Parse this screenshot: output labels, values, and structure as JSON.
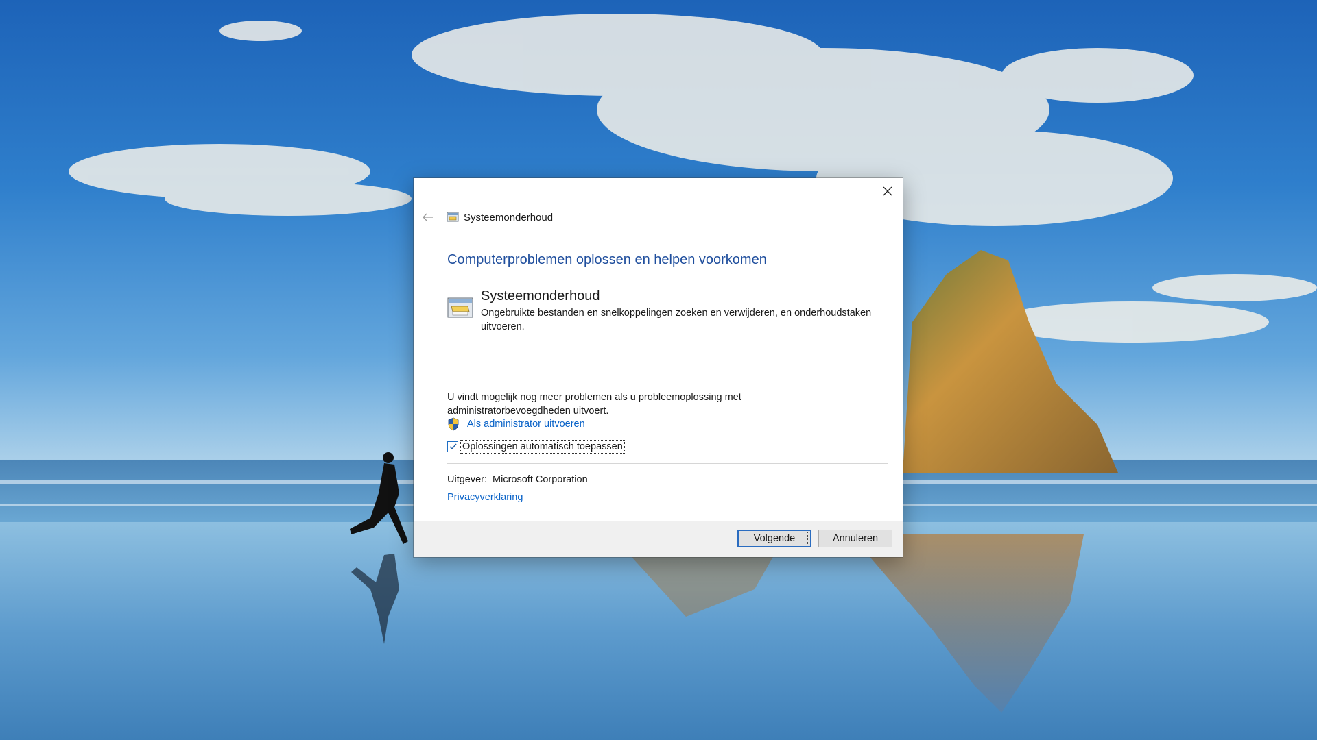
{
  "dialog": {
    "header_title": "Systeemonderhoud",
    "page_title": "Computerproblemen oplossen en helpen voorkomen",
    "item": {
      "name": "Systeemonderhoud",
      "description": "Ongebruikte bestanden en snelkoppelingen zoeken en verwijderen, en onderhoudstaken uitvoeren."
    },
    "admin_text": "U vindt mogelijk nog meer problemen als u probleemoplossing met administratorbevoegdheden uitvoert.",
    "admin_link": "Als administrator uitvoeren",
    "checkbox": {
      "label": "Oplossingen automatisch toepassen",
      "checked": true
    },
    "publisher_label": "Uitgever:",
    "publisher_value": "Microsoft Corporation",
    "privacy_link": "Privacyverklaring",
    "buttons": {
      "next": "Volgende",
      "cancel": "Annuleren"
    }
  },
  "icons": {
    "close": "close-icon",
    "back": "back-arrow-icon",
    "maintenance": "system-maintenance-icon",
    "shield": "uac-shield-icon",
    "check": "checkmark-icon"
  },
  "colors": {
    "title_blue": "#1f4e9d",
    "link_blue": "#0a63c8",
    "footer_bg": "#f0f0f0",
    "primary_button_border": "#2a6cc0"
  }
}
